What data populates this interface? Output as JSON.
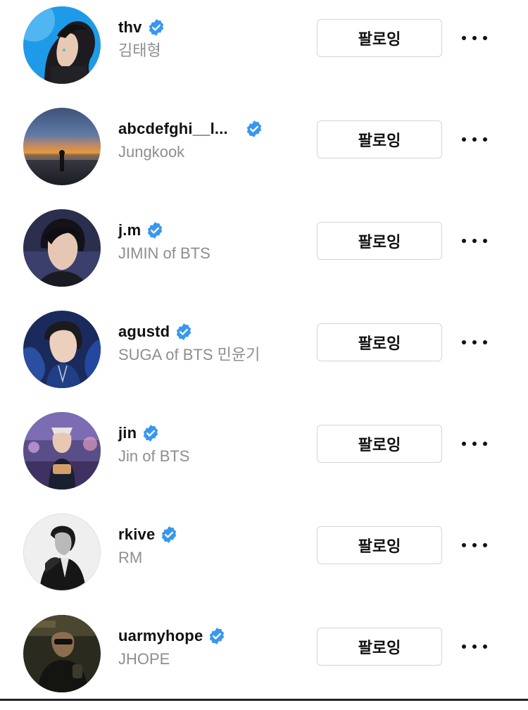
{
  "follow_label": "팔로잉",
  "colors": {
    "verified": "#3897f0",
    "username": "#111111",
    "fullname": "#8e8e8e",
    "button_border": "#d4d4d4"
  },
  "accounts": [
    {
      "username": "thv",
      "fullname": "김태형",
      "verified": true,
      "avatar_icon": "avatar-blue-profile",
      "button": "팔로잉"
    },
    {
      "username": "abcdefghi__l...",
      "fullname": "Jungkook",
      "verified": true,
      "avatar_icon": "avatar-sunset-beach",
      "button": "팔로잉"
    },
    {
      "username": "j.m",
      "fullname": "JIMIN of BTS",
      "verified": true,
      "avatar_icon": "avatar-portrait-dark",
      "button": "팔로잉"
    },
    {
      "username": "agustd",
      "fullname": "SUGA of BTS 민윤기",
      "verified": true,
      "avatar_icon": "avatar-blue-jacket",
      "button": "팔로잉"
    },
    {
      "username": "jin",
      "fullname": "Jin of BTS",
      "verified": true,
      "avatar_icon": "avatar-carnival",
      "button": "팔로잉"
    },
    {
      "username": "rkive",
      "fullname": "RM",
      "verified": true,
      "avatar_icon": "avatar-monochrome",
      "button": "팔로잉"
    },
    {
      "username": "uarmyhope",
      "fullname": "JHOPE",
      "verified": true,
      "avatar_icon": "avatar-dark-cafe",
      "button": "팔로잉"
    }
  ]
}
